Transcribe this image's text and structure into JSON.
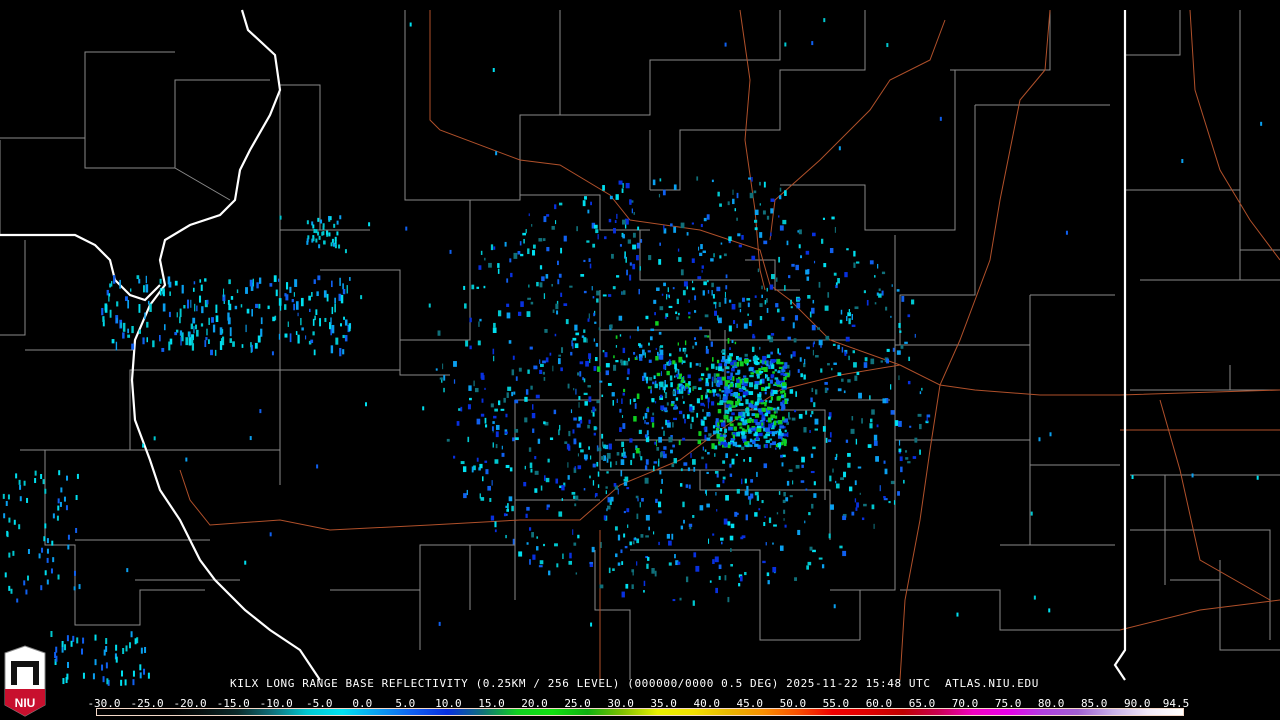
{
  "product": {
    "caption": "KILX LONG RANGE BASE REFLECTIVITY (0.25KM / 256 LEVEL) (000000/0000 0.5 DEG) 2025-11-22 15:48 UTC  ATLAS.NIU.EDU",
    "radar_site": "KILX",
    "timestamp": "2025-11-22 15:48 UTC",
    "elevation": "0.5 DEG",
    "source": "ATLAS.NIU.EDU"
  },
  "logo": {
    "text": "NIU"
  },
  "colorbar": {
    "tick_labels": [
      "-30.0",
      "-25.0",
      "-20.0",
      "-15.0",
      "-10.0",
      "-5.0",
      "0.0",
      "5.0",
      "10.0",
      "15.0",
      "20.0",
      "25.0",
      "30.0",
      "35.0",
      "40.0",
      "45.0",
      "50.0",
      "55.0",
      "60.0",
      "65.0",
      "70.0",
      "75.0",
      "80.0",
      "85.0",
      "90.0",
      "94.5"
    ],
    "min": -30,
    "max": 94.5,
    "colors": [
      "#000000",
      "#000000",
      "#000000",
      "#061010",
      "#0a2a2a",
      "#10707a",
      "#00c8d0",
      "#00e0f0",
      "#0aa0f0",
      "#1060f0",
      "#0830e0",
      "#10707a",
      "#10d020",
      "#10e010",
      "#10b010",
      "#80c000",
      "#e8f000",
      "#f0e000",
      "#e8b800",
      "#f89000",
      "#f85000",
      "#f00000",
      "#e00000",
      "#c00000",
      "#c80050",
      "#f000c0",
      "#e800e8",
      "#b040e0",
      "#a060d0",
      "#c8b0e8",
      "#f0e8f8",
      "#ffffff"
    ],
    "accent": {
      "state_border": "#ffffff",
      "county_border": "#8a8a8a",
      "highway": "#b0502a"
    }
  }
}
